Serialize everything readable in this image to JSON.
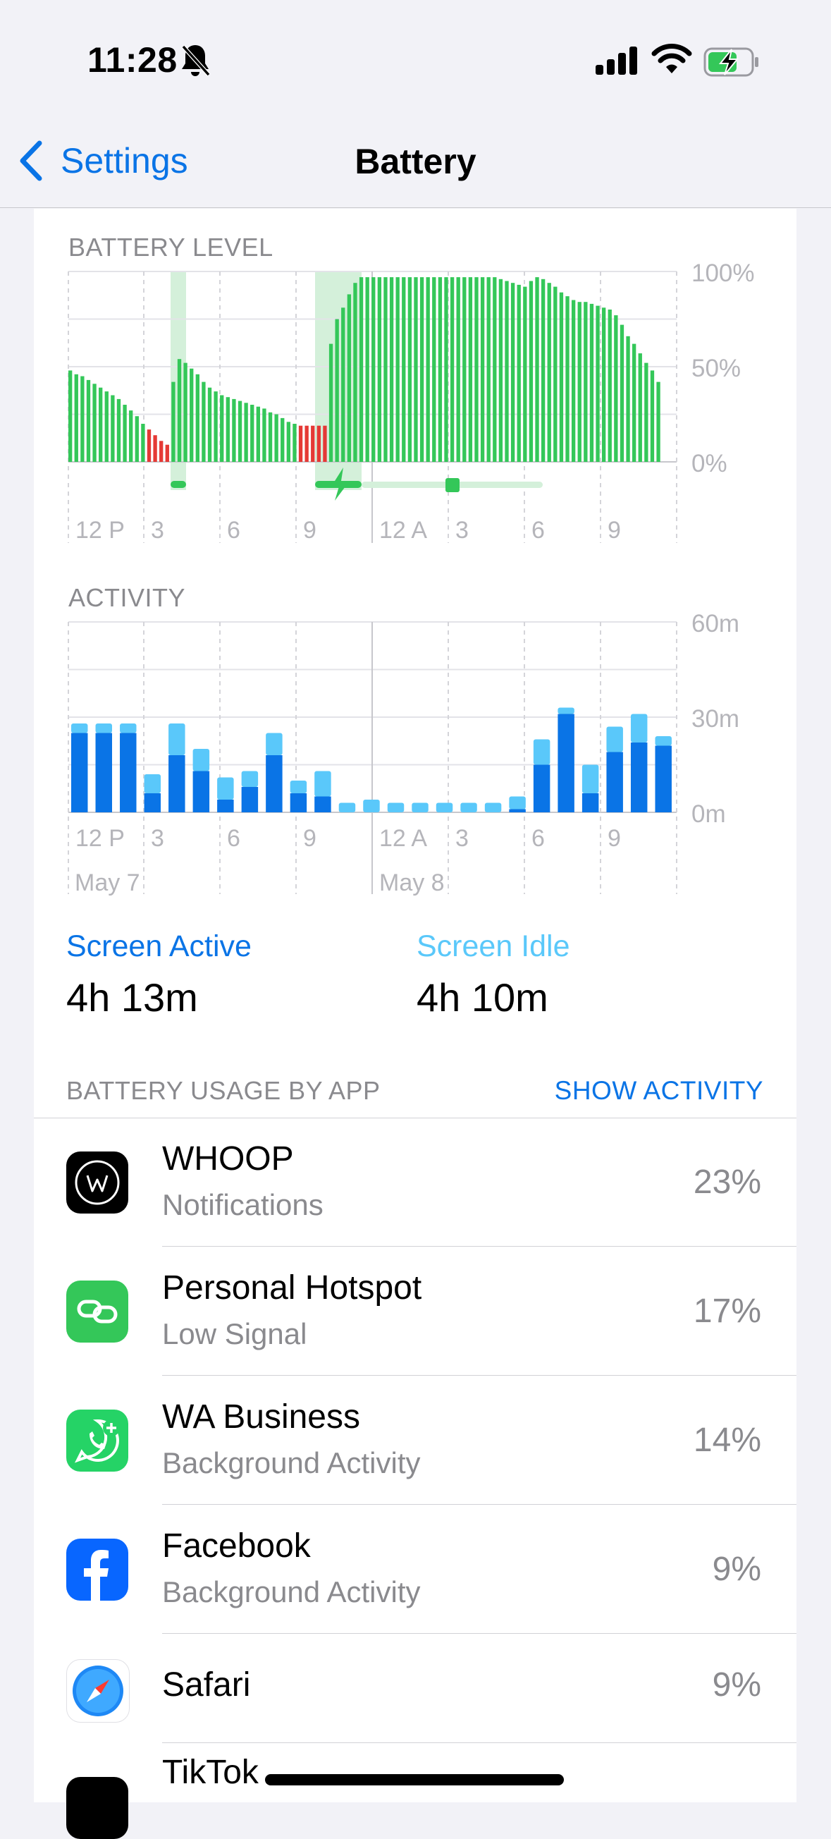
{
  "status_bar": {
    "time": "11:28",
    "icons": [
      "bell-slash-icon",
      "cellular-signal-icon",
      "wifi-icon",
      "battery-charging-icon"
    ]
  },
  "nav": {
    "back_label": "Settings",
    "title": "Battery"
  },
  "battery_level": {
    "label": "BATTERY LEVEL",
    "y_ticks": [
      "100%",
      "50%",
      "0%"
    ],
    "x_ticks": [
      "12 P",
      "3",
      "6",
      "9",
      "12 A",
      "3",
      "6",
      "9"
    ]
  },
  "activity": {
    "label": "ACTIVITY",
    "y_ticks": [
      "60m",
      "30m",
      "0m"
    ],
    "x_ticks": [
      "12 P",
      "3",
      "6",
      "9",
      "12 A",
      "3",
      "6",
      "9"
    ],
    "dates": [
      "May 7",
      "May 8"
    ]
  },
  "screen": {
    "active_label": "Screen Active",
    "active_value": "4h 13m",
    "idle_label": "Screen Idle",
    "idle_value": "4h 10m"
  },
  "usage": {
    "header": "BATTERY USAGE BY APP",
    "toggle": "SHOW ACTIVITY",
    "apps": [
      {
        "name": "WHOOP",
        "sub": "Notifications",
        "pct": "23%",
        "icon": "whoop-icon"
      },
      {
        "name": "Personal Hotspot",
        "sub": "Low Signal",
        "pct": "17%",
        "icon": "hotspot-icon"
      },
      {
        "name": "WA Business",
        "sub": "Background Activity",
        "pct": "14%",
        "icon": "whatsapp-business-icon"
      },
      {
        "name": "Facebook",
        "sub": "Background Activity",
        "pct": "9%",
        "icon": "facebook-icon"
      },
      {
        "name": "Safari",
        "sub": "",
        "pct": "9%",
        "icon": "safari-icon"
      },
      {
        "name": "TikTok",
        "sub": "",
        "pct": "",
        "icon": "tiktok-icon"
      }
    ]
  },
  "colors": {
    "accent": "#0a74e6",
    "battery_green": "#34c759",
    "battery_red": "#e53935",
    "charging_band": "#d4f0da",
    "activity_dark": "#0a74e6",
    "activity_light": "#5ac8fa"
  },
  "chart_data": [
    {
      "type": "bar",
      "title": "BATTERY LEVEL",
      "ylim": [
        0,
        100
      ],
      "y_ticks": [
        "0%",
        "50%",
        "100%"
      ],
      "x_ticks": [
        "12 P",
        "3",
        "6",
        "9",
        "12 A",
        "3",
        "6",
        "9"
      ],
      "values": [
        48,
        46,
        45,
        43,
        41,
        39,
        37,
        35,
        33,
        30,
        27,
        24,
        20,
        17,
        14,
        11,
        9,
        42,
        54,
        52,
        49,
        46,
        42,
        39,
        37,
        35,
        34,
        33,
        32,
        31,
        30,
        29,
        28,
        26,
        25,
        23,
        21,
        20,
        19,
        19,
        19,
        19,
        19,
        62,
        75,
        81,
        88,
        94,
        97,
        97,
        97,
        97,
        97,
        97,
        97,
        97,
        97,
        97,
        97,
        97,
        97,
        97,
        97,
        97,
        97,
        97,
        97,
        97,
        97,
        97,
        97,
        96,
        95,
        94,
        93,
        92,
        95,
        97,
        96,
        94,
        92,
        89,
        87,
        85,
        84,
        84,
        83,
        82,
        81,
        80,
        77,
        72,
        66,
        62,
        57,
        52,
        48,
        42
      ],
      "low_battery_bars": [
        13,
        14,
        15,
        16,
        38,
        39,
        40,
        41,
        42
      ],
      "charging_periods": [
        "~3 P",
        "~9:30 P–10:30 P"
      ]
    },
    {
      "type": "bar",
      "title": "ACTIVITY",
      "ylim": [
        0,
        60
      ],
      "y_ticks": [
        "0m",
        "30m",
        "60m"
      ],
      "x_ticks": [
        "12 P",
        "3",
        "6",
        "9",
        "12 A",
        "3",
        "6",
        "9"
      ],
      "series": [
        {
          "name": "Screen Active",
          "values": [
            25,
            25,
            25,
            6,
            18,
            13,
            4,
            8,
            18,
            6,
            5,
            0,
            0,
            0,
            0,
            0,
            0,
            0,
            1,
            15,
            31,
            6,
            19,
            22,
            21
          ]
        },
        {
          "name": "Screen Idle",
          "values": [
            3,
            3,
            3,
            6,
            10,
            7,
            7,
            5,
            7,
            4,
            8,
            3,
            4,
            3,
            3,
            3,
            3,
            3,
            4,
            8,
            2,
            9,
            8,
            9,
            3
          ]
        }
      ]
    }
  ]
}
